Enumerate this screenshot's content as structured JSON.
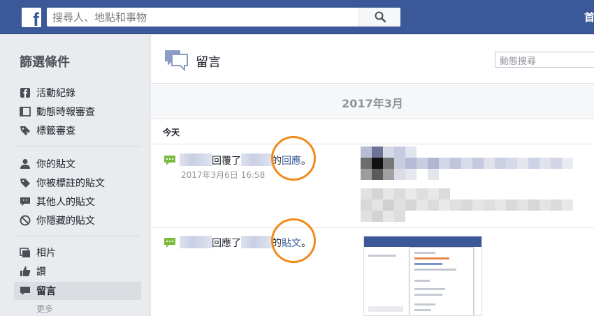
{
  "topbar": {
    "logo": "f",
    "search_placeholder": "搜尋人、地點和事物",
    "home_label": "首頁"
  },
  "sidebar": {
    "title": "篩選條件",
    "groups": [
      [
        {
          "label": "活動紀錄",
          "icon": "facebook-icon"
        },
        {
          "label": "動態時報審查",
          "icon": "timeline-icon"
        },
        {
          "label": "標籤審查",
          "icon": "tag-review-icon"
        }
      ],
      [
        {
          "label": "你的貼文",
          "icon": "person-icon"
        },
        {
          "label": "你被標註的貼文",
          "icon": "tag-icon"
        },
        {
          "label": "其他人的貼文",
          "icon": "comment-icon"
        },
        {
          "label": "你隱藏的貼文",
          "icon": "hidden-icon"
        }
      ],
      [
        {
          "label": "相片",
          "icon": "photos-icon"
        },
        {
          "label": "讚",
          "icon": "like-icon"
        },
        {
          "label": "留言",
          "icon": "comment-icon",
          "active": true
        }
      ]
    ],
    "more_label": "更多"
  },
  "main": {
    "header_title": "留言",
    "activity_search_placeholder": "動態搜尋",
    "month_label": "2017年3月",
    "day_label": "今天",
    "entries": [
      {
        "verb": "回覆了",
        "possessive": "的",
        "object_link": "回應",
        "period": "。",
        "timestamp": "2017年3月6日 16:58"
      },
      {
        "verb": "回應了",
        "possessive": "的",
        "object_link": "貼文",
        "period": "。"
      }
    ]
  },
  "colors": {
    "brand_blue": "#3b5998",
    "link_blue": "#365899",
    "highlight_ring": "#f28a19",
    "comment_icon_green": "#7cbb3f"
  }
}
